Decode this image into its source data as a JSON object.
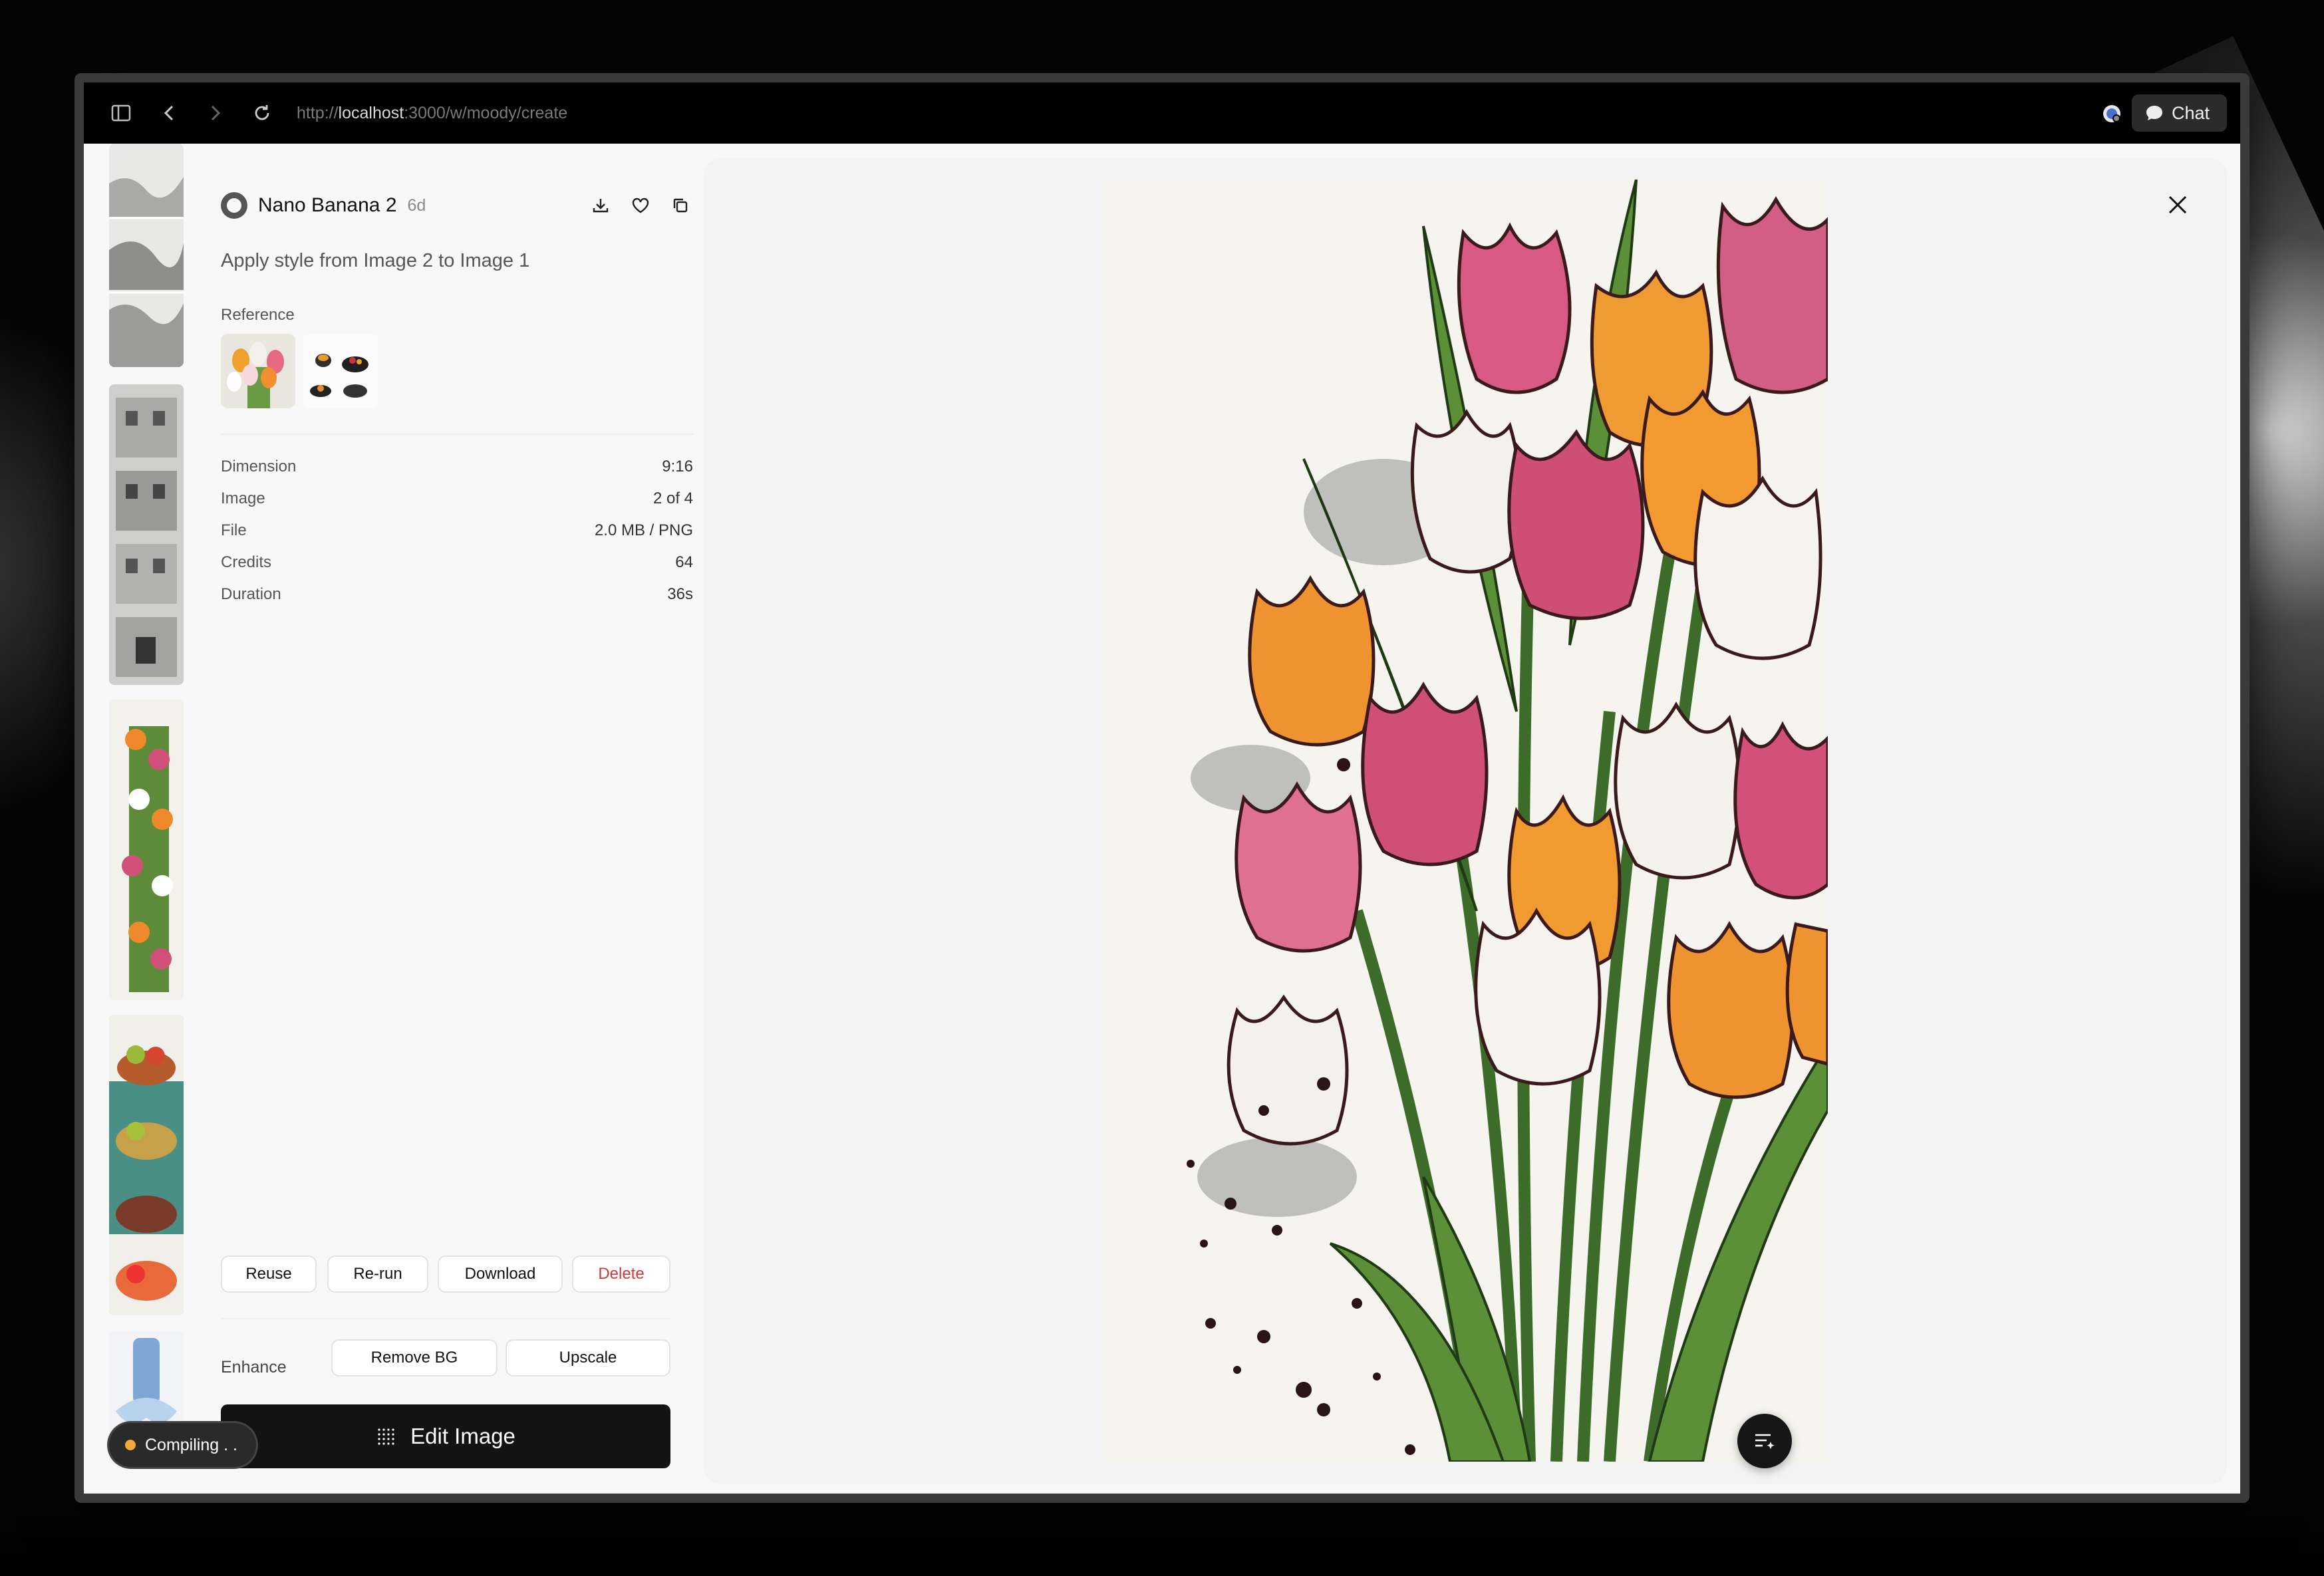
{
  "browser": {
    "url_scheme": "http://",
    "url_host": "localhost",
    "url_path": ":3000/w/moody/create",
    "chat_label": "Chat"
  },
  "detail": {
    "model_name": "Nano Banana 2",
    "age": "6d",
    "prompt": "Apply style from Image 2 to Image 1",
    "reference_label": "Reference",
    "meta": [
      {
        "key": "Dimension",
        "value": "9:16"
      },
      {
        "key": "Image",
        "value": "2 of 4"
      },
      {
        "key": "File",
        "value": "2.0 MB / PNG"
      },
      {
        "key": "Credits",
        "value": "64"
      },
      {
        "key": "Duration",
        "value": "36s"
      }
    ]
  },
  "actions": {
    "reuse": "Reuse",
    "rerun": "Re-run",
    "download": "Download",
    "delete": "Delete",
    "enhance_label": "Enhance",
    "remove_bg": "Remove BG",
    "upscale": "Upscale",
    "edit_image": "Edit Image"
  },
  "status": {
    "compiling": "Compiling . ."
  },
  "colors": {
    "accent_dark": "#131313",
    "delete_red": "#d03a3a",
    "status_orange": "#f2a93b"
  }
}
